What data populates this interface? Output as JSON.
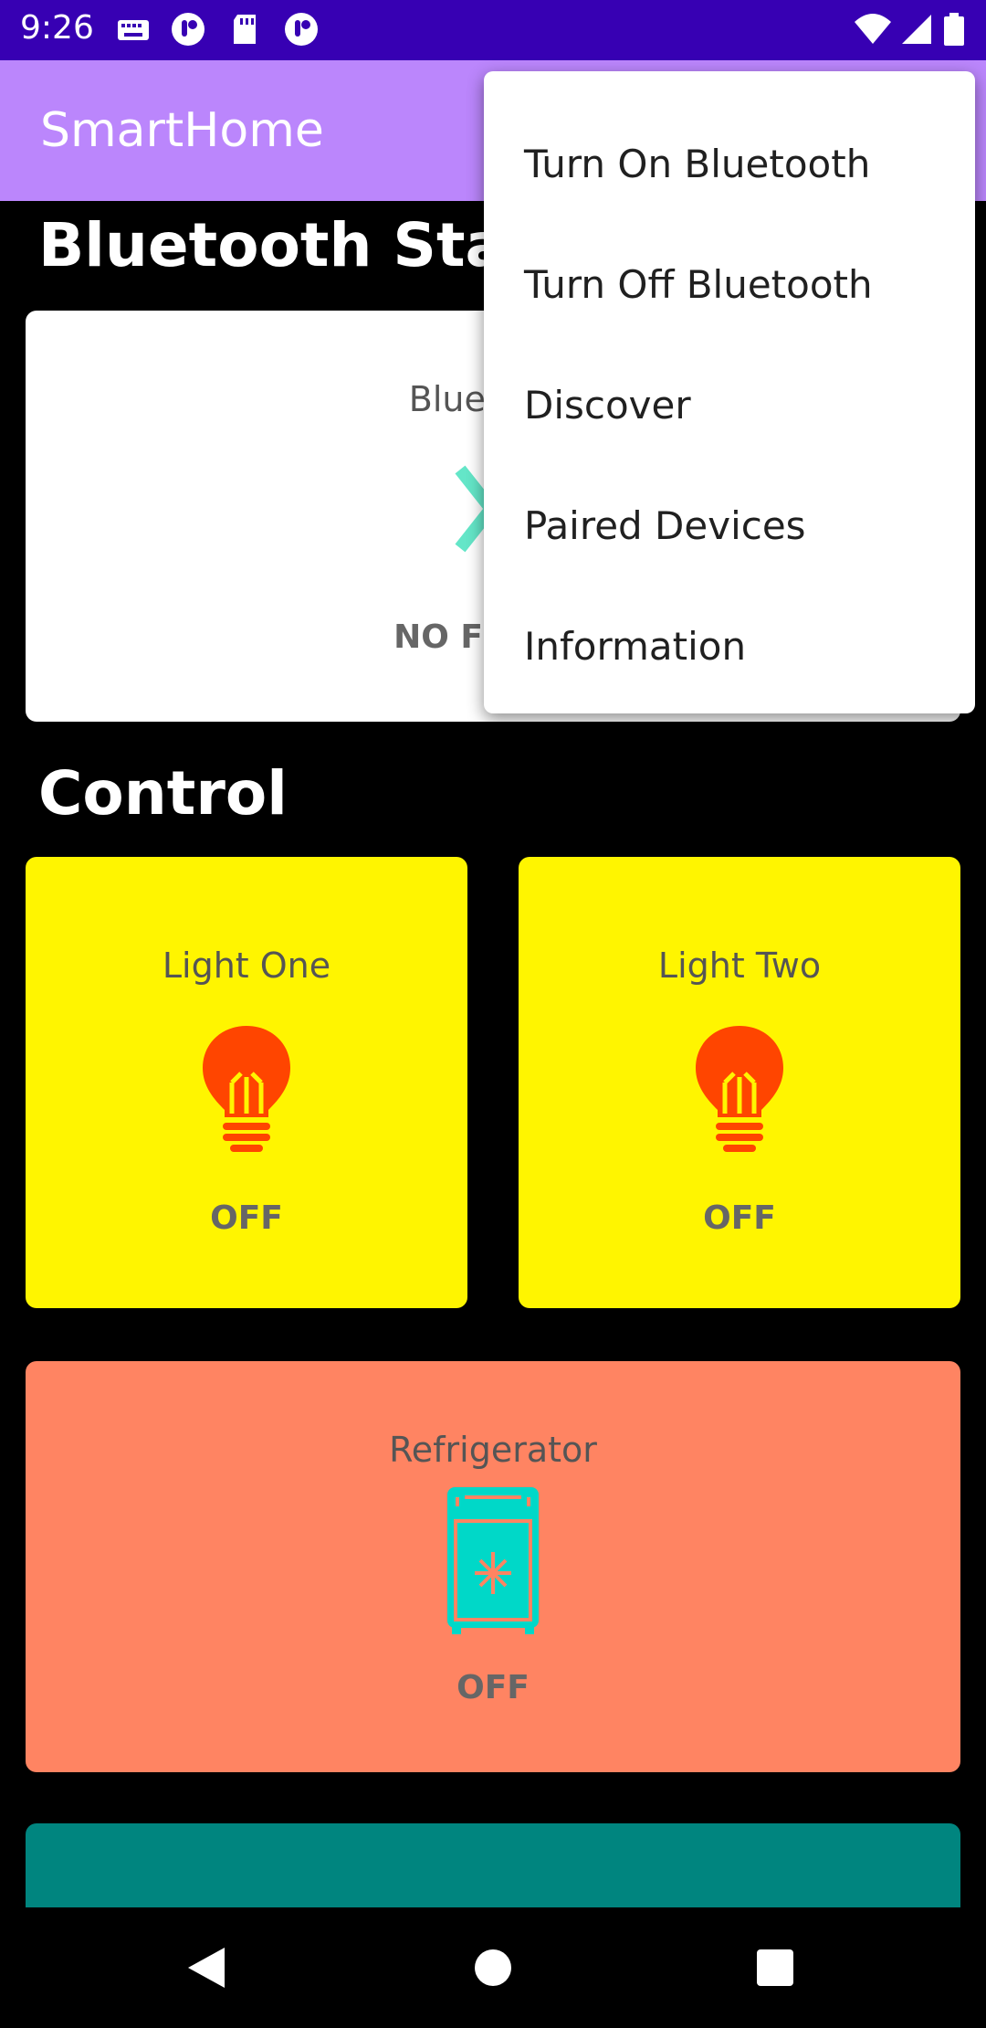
{
  "status_bar": {
    "time": "9:26",
    "left_icons": [
      "keyboard-icon",
      "app-notification-icon",
      "sd-card-icon",
      "app-notification-icon"
    ],
    "right_icons": [
      "wifi-icon",
      "signal-icon",
      "battery-icon"
    ]
  },
  "app_bar": {
    "title": "SmartHome"
  },
  "sections": {
    "bluetooth_status": "Bluetooth Status",
    "control": "Control"
  },
  "bluetooth_card": {
    "label": "Bluetooth",
    "state": "NO FOUND",
    "icon": "bluetooth-icon",
    "icon_color": "#64e6c8"
  },
  "controls": [
    {
      "label": "Light One",
      "state": "OFF",
      "icon": "light-bulb-icon",
      "bg": "#fff500"
    },
    {
      "label": "Light Two",
      "state": "OFF",
      "icon": "light-bulb-icon",
      "bg": "#fff500"
    },
    {
      "label": "Refrigerator",
      "state": "OFF",
      "icon": "refrigerator-icon",
      "bg": "#ff8462"
    }
  ],
  "overflow_menu": {
    "items": [
      "Turn On Bluetooth",
      "Turn Off Bluetooth",
      "Discover",
      "Paired Devices",
      "Information"
    ]
  },
  "colors": {
    "status_bar": "#3700b3",
    "app_bar": "#bb86fc",
    "bulb": "#ff4500",
    "fridge": "#00d8c8",
    "teal_card": "#00857f"
  },
  "nav_bar": {
    "icons": [
      "back-icon",
      "home-icon",
      "recents-icon"
    ]
  }
}
